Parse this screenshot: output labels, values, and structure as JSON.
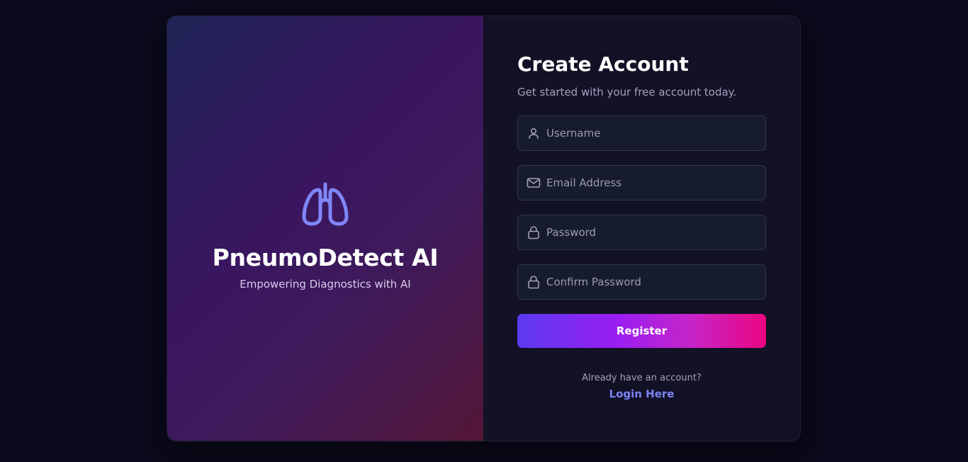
{
  "brand": {
    "title": "PneumoDetect AI",
    "tagline": "Empowering Diagnostics with AI",
    "icon": "lungs-icon",
    "icon_color": "#7f86f7"
  },
  "form": {
    "title": "Create Account",
    "subtitle": "Get started with your free account today.",
    "fields": [
      {
        "icon": "user-icon",
        "placeholder": "Username",
        "value": ""
      },
      {
        "icon": "mail-icon",
        "placeholder": "Email Address",
        "value": ""
      },
      {
        "icon": "lock-icon",
        "placeholder": "Password",
        "value": ""
      },
      {
        "icon": "lock-icon",
        "placeholder": "Confirm Password",
        "value": ""
      }
    ],
    "register_label": "Register",
    "login_prompt": "Already have an account?",
    "login_link": "Login Here"
  },
  "colors": {
    "background": "#0b0a1c",
    "form_panel": "#121126",
    "accent": "#7b83f4",
    "button_gradient_start": "#5b3af2",
    "button_gradient_end": "#ea0680"
  }
}
